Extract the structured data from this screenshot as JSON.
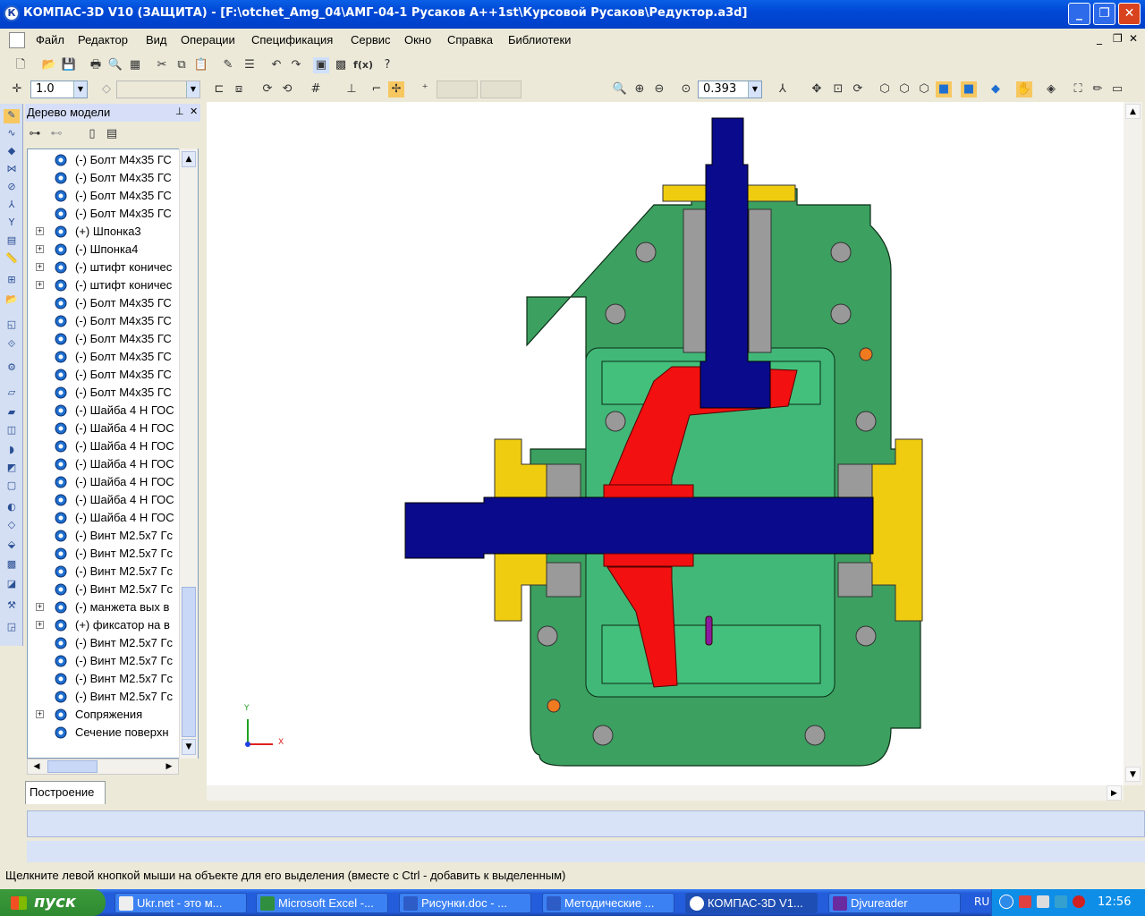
{
  "window": {
    "title": "КОМПАС-3D V10 (ЗАЩИТА) - [F:\\otchet_Amg_04\\АМГ-04-1 Русаков А++1st\\Курсовой Русаков\\Редуктор.a3d]",
    "app_icon": "К"
  },
  "menu": [
    "Файл",
    "Редактор",
    "Вид",
    "Операции",
    "Спецификация",
    "Сервис",
    "Окно",
    "Справка",
    "Библиотеки"
  ],
  "toolbar": {
    "step_value": "1.0",
    "zoom_value": "0.393",
    "fx_label": "f(x)"
  },
  "tree": {
    "header": "Дерево модели",
    "items": [
      {
        "text": "(-) Болт М4x35 ГС",
        "exp": ""
      },
      {
        "text": "(-) Болт М4x35 ГС",
        "exp": ""
      },
      {
        "text": "(-) Болт М4x35 ГС",
        "exp": ""
      },
      {
        "text": "(-) Болт М4x35 ГС",
        "exp": ""
      },
      {
        "text": "(+) Шпонка3",
        "exp": "+"
      },
      {
        "text": "(-) Шпонка4",
        "exp": "+"
      },
      {
        "text": "(-) штифт коничес",
        "exp": "+"
      },
      {
        "text": "(-) штифт коничес",
        "exp": "+"
      },
      {
        "text": "(-) Болт М4x35 ГС",
        "exp": ""
      },
      {
        "text": "(-) Болт М4x35 ГС",
        "exp": ""
      },
      {
        "text": "(-) Болт М4x35 ГС",
        "exp": ""
      },
      {
        "text": "(-) Болт М4x35 ГС",
        "exp": ""
      },
      {
        "text": "(-) Болт М4x35 ГС",
        "exp": ""
      },
      {
        "text": "(-) Болт М4x35 ГС",
        "exp": ""
      },
      {
        "text": "(-) Шайба 4 Н ГОС",
        "exp": ""
      },
      {
        "text": "(-) Шайба 4 Н ГОС",
        "exp": ""
      },
      {
        "text": "(-) Шайба 4 Н ГОС",
        "exp": ""
      },
      {
        "text": "(-) Шайба 4 Н ГОС",
        "exp": ""
      },
      {
        "text": "(-) Шайба 4 Н ГОС",
        "exp": ""
      },
      {
        "text": "(-) Шайба 4 Н ГОС",
        "exp": ""
      },
      {
        "text": "(-) Шайба 4 Н ГОС",
        "exp": ""
      },
      {
        "text": "(-) Винт М2.5x7 Гс",
        "exp": ""
      },
      {
        "text": "(-) Винт М2.5x7 Гс",
        "exp": ""
      },
      {
        "text": "(-) Винт М2.5x7 Гс",
        "exp": ""
      },
      {
        "text": "(-) Винт М2.5x7 Гс",
        "exp": ""
      },
      {
        "text": "(-) манжета вых в",
        "exp": "+"
      },
      {
        "text": "(+) фиксатор на в",
        "exp": "+"
      },
      {
        "text": "(-) Винт М2.5x7 Гс",
        "exp": ""
      },
      {
        "text": "(-) Винт М2.5x7 Гс",
        "exp": ""
      },
      {
        "text": "(-) Винт М2.5x7 Гс",
        "exp": ""
      },
      {
        "text": "(-) Винт М2.5x7 Гс",
        "exp": ""
      },
      {
        "text": "Сопряжения",
        "exp": "+"
      },
      {
        "text": "Сечение поверхн",
        "exp": ""
      }
    ],
    "tab": "Построение"
  },
  "axes": {
    "x": "X",
    "y": "Y"
  },
  "status_hint": "Щелкните левой кнопкой мыши на объекте для его выделения (вместе с Ctrl - добавить к выделенным)",
  "taskbar": {
    "start": "пуск",
    "tasks": [
      "Ukr.net - это м...",
      "Microsoft Excel -...",
      "Рисунки.doc - ...",
      "Методические ...",
      "КОМПАС-3D V1...",
      "Djvureader"
    ],
    "lang": "RU",
    "clock": "12:56"
  },
  "colors": {
    "housing": "#3CA060",
    "shaft": "#0A0A8C",
    "gear": "#F21010",
    "cap": "#F0CC10",
    "taskbar": "#245DDB"
  }
}
